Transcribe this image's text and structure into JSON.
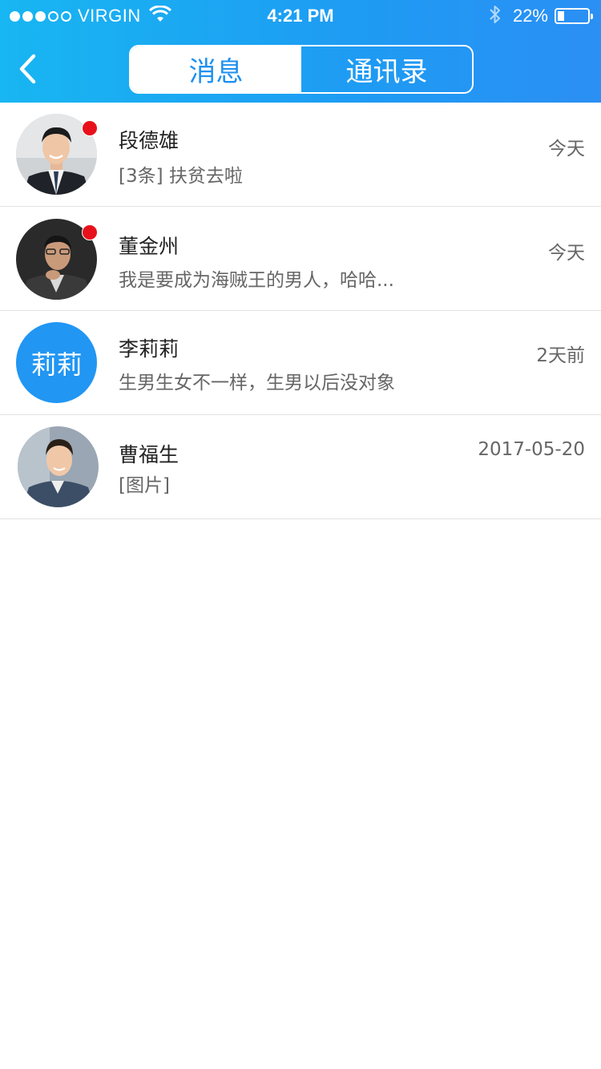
{
  "status_bar": {
    "carrier": "VIRGIN",
    "time": "4:21 PM",
    "battery": "22%",
    "battery_level": 0.22,
    "signal_bars_filled": 3,
    "signal_bars_total": 5
  },
  "nav": {
    "tabs": [
      {
        "label": "消息",
        "active": true
      },
      {
        "label": "通讯录",
        "active": false
      }
    ]
  },
  "colors": {
    "header_start": "#18b6f2",
    "header_end": "#2b8ff4",
    "accent": "#1e90f0",
    "badge": "#e8111b",
    "text_avatar_bg": "#2196f3"
  },
  "conversations": [
    {
      "name": "段德雄",
      "preview": "[3条] 扶贫去啦",
      "time": "今天",
      "unread": true,
      "avatar": "photo"
    },
    {
      "name": "董金州",
      "preview": "我是要成为海贼王的男人，哈哈...",
      "time": "今天",
      "unread": true,
      "avatar": "photo"
    },
    {
      "name": "李莉莉",
      "preview": "生男生女不一样，生男以后没对象",
      "time": "2天前",
      "unread": false,
      "avatar": "text",
      "avatar_text": "莉莉"
    },
    {
      "name": "曹福生",
      "preview": "[图片]",
      "time": "2017-05-20",
      "unread": false,
      "avatar": "photo"
    }
  ]
}
